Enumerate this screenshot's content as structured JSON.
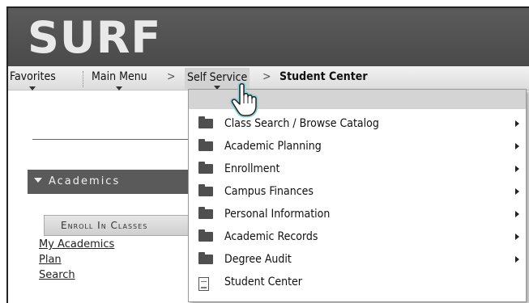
{
  "app": {
    "logo_text": "SURF"
  },
  "nav": {
    "favorites": "Favorites",
    "main_menu": "Main Menu",
    "separator": ">",
    "self_service": "Self Service",
    "current": "Student Center"
  },
  "sidebar": {
    "academics_header": "Academics",
    "enroll_button": "Enroll In Classes",
    "links": [
      "My Academics",
      "Plan",
      "Search"
    ]
  },
  "dropdown": {
    "items": [
      {
        "label": "Class Search / Browse Catalog",
        "icon": "folder-icon",
        "has_submenu": true
      },
      {
        "label": "Academic Planning",
        "icon": "folder-icon",
        "has_submenu": true
      },
      {
        "label": "Enrollment",
        "icon": "folder-icon",
        "has_submenu": true
      },
      {
        "label": "Campus Finances",
        "icon": "folder-icon",
        "has_submenu": true
      },
      {
        "label": "Personal Information",
        "icon": "folder-icon",
        "has_submenu": true
      },
      {
        "label": "Academic Records",
        "icon": "folder-icon",
        "has_submenu": true
      },
      {
        "label": "Degree Audit",
        "icon": "folder-icon",
        "has_submenu": true
      },
      {
        "label": "Student Center",
        "icon": "document-icon",
        "has_submenu": false
      }
    ]
  },
  "colors": {
    "banner": "#4a4a4a",
    "logo": "#e9e9e9",
    "navbar": "#dcdcdc",
    "academics_header": "#5a5a5a",
    "cursor_accent": "#8fd3d6"
  }
}
